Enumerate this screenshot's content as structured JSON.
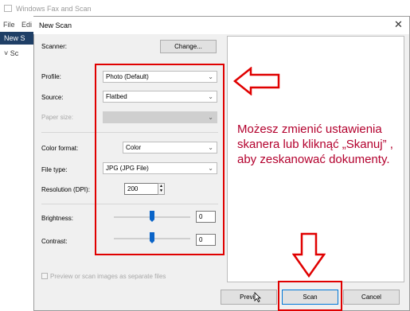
{
  "background_app": {
    "title": "Windows Fax and Scan",
    "menu": [
      "File",
      "Edi"
    ],
    "toolbar_new_scan": "New S",
    "tree_item": "Sc"
  },
  "dialog": {
    "title": "New Scan",
    "close_glyph": "✕",
    "scanner": {
      "label": "Scanner:",
      "change_button": "Change..."
    },
    "profile": {
      "label": "Profile:",
      "value": "Photo (Default)"
    },
    "source": {
      "label": "Source:",
      "value": "Flatbed"
    },
    "paper_size": {
      "label": "Paper size:",
      "value": ""
    },
    "color_format": {
      "label": "Color format:",
      "value": "Color"
    },
    "file_type": {
      "label": "File type:",
      "value": "JPG (JPG File)"
    },
    "resolution": {
      "label": "Resolution (DPI):",
      "value": "200"
    },
    "brightness": {
      "label": "Brightness:",
      "value": "0",
      "level": 0.5
    },
    "contrast": {
      "label": "Contrast:",
      "value": "0",
      "level": 0.5
    },
    "separate_files": {
      "label": "Preview or scan images as separate files",
      "checked": false
    },
    "buttons": {
      "preview": "Previe",
      "scan": "Scan",
      "cancel": "Cancel"
    }
  },
  "annotation": {
    "text": "Możesz zmienić ustawienia skanera lub kliknąć „Skanuj” , aby zeskanować dokumenty.",
    "color": "#b3002d",
    "highlight_color": "#e00000"
  },
  "icons": [
    "app-icon",
    "close-icon",
    "chevron-down-icon",
    "spin-up-icon",
    "spin-down-icon",
    "arrow-left-icon",
    "arrow-down-icon",
    "mouse-cursor-icon"
  ]
}
